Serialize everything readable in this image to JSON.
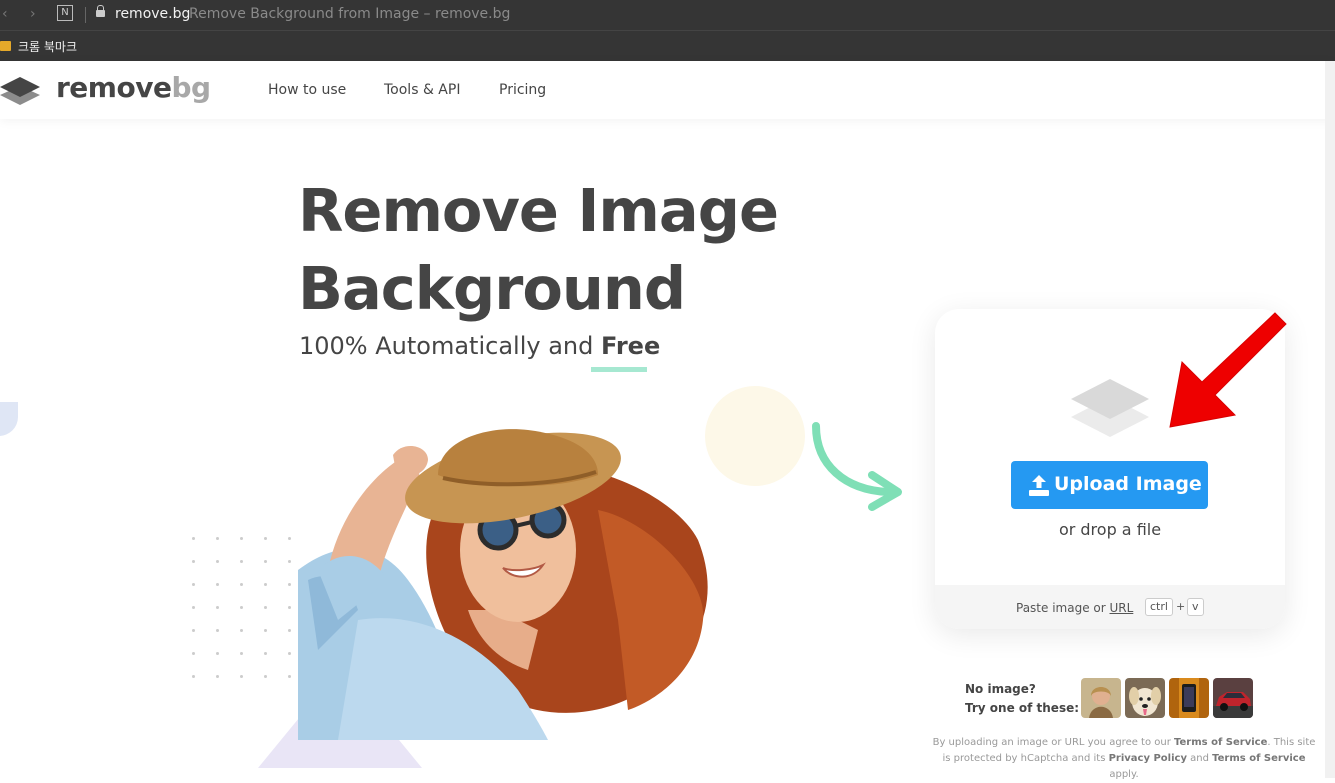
{
  "browser": {
    "domain": "remove.bg",
    "page_title": "Remove Background from Image – remove.bg",
    "bookmark_folder": "크롬 북마크",
    "tab_badge": "N"
  },
  "header": {
    "logo_part1": "remove",
    "logo_part2": "bg",
    "nav": [
      "How to use",
      "Tools & API",
      "Pricing"
    ]
  },
  "hero": {
    "title_line1": "Remove Image",
    "title_line2": "Background",
    "subtitle": "100% Automatically and ",
    "subtitle_emphasis": "Free"
  },
  "upload": {
    "button_label": "Upload Image",
    "drop_text": "or drop a file",
    "paste_prefix": "Paste image or ",
    "paste_url": "URL",
    "key1": "ctrl",
    "plus": "+",
    "key2": "v"
  },
  "samples": {
    "line1": "No image?",
    "line2": "Try one of these:",
    "items": [
      "woman-sample-thumbnail",
      "dog-sample-thumbnail",
      "phone-sample-thumbnail",
      "car-sample-thumbnail"
    ]
  },
  "legal": {
    "t1": "By uploading an image or URL you agree to our ",
    "terms1": "Terms of Service",
    "t2": ". This site is protected by hCaptcha and its ",
    "privacy": "Privacy Policy",
    "t3": " and ",
    "terms2": "Terms of Service",
    "t4": " apply."
  },
  "colors": {
    "accent": "#2599f2",
    "text": "#454545",
    "highlight": "#a6e8d1",
    "annotation_arrow": "#ee0000"
  }
}
